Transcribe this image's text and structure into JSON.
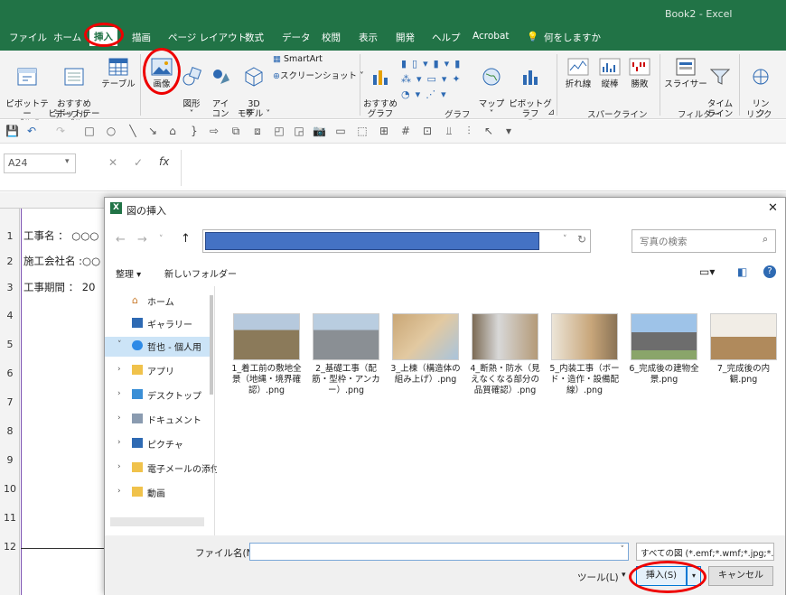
{
  "window": {
    "title": "Book2 - Excel"
  },
  "tabs": [
    "ファイル",
    "ホーム",
    "挿入",
    "描画",
    "ページ レイアウト",
    "数式",
    "データ",
    "校閲",
    "表示",
    "開発",
    "ヘルプ",
    "Acrobat"
  ],
  "tell_me": "何をしますか",
  "ribbon": {
    "pivot": "ピボットテー\nブル ˅",
    "rec_pivot": "おすすめ\nピボットテーブル",
    "table": "テーブル",
    "image": "画像",
    "shapes": "図形\n˅",
    "icons": "アイ\nコン",
    "model3d": "3D\nモデル ˅",
    "smartart": "SmartArt",
    "screenshot": "スクリーンショット ˅",
    "rec_chart": "おすすめ\nグラフ",
    "map": "マップ\n˅",
    "pivot_chart": "ピボットグラフ\n˅",
    "line": "折れ線",
    "column": "縦棒",
    "winloss": "勝敗",
    "slicer": "スライサー",
    "timeline": "タイム\nライン",
    "link": "リン\nク",
    "groups": {
      "table": "テーブル",
      "chart": "グラフ",
      "sparkline": "スパークライン",
      "filter": "フィルター",
      "link": "リンク"
    }
  },
  "namebox": "A24",
  "sheet": {
    "rows": [
      "1",
      "2",
      "3",
      "4",
      "5",
      "6",
      "7",
      "8",
      "9",
      "10",
      "11",
      "12"
    ],
    "cells": [
      "工事名 ： ○○○",
      "施工会社名 :○○",
      "工事期間 ：  20"
    ]
  },
  "dialog": {
    "title": "図の挿入",
    "search_placeholder": "写真の検索",
    "organize": "整理 ▾",
    "new_folder": "新しいフォルダー",
    "nav": [
      {
        "label": "ホーム",
        "chev": ""
      },
      {
        "label": "ギャラリー",
        "chev": ""
      },
      {
        "label": "哲也 - 個人用",
        "chev": "˅"
      },
      {
        "label": "アプリ",
        "chev": "›"
      },
      {
        "label": "デスクトップ",
        "chev": "›"
      },
      {
        "label": "ドキュメント",
        "chev": "›"
      },
      {
        "label": "ピクチャ",
        "chev": "›"
      },
      {
        "label": "電子メールの添付",
        "chev": "›"
      },
      {
        "label": "動画",
        "chev": "›"
      }
    ],
    "files": [
      "1_着工前の敷地全景（地縄・境界確認）.png",
      "2_基礎工事（配筋・型枠・アンカー）.png",
      "3_上棟（構造体の組み上げ）.png",
      "4_断熱・防水（見えなくなる部分の品質確認）.png",
      "5_内装工事（ボード・造作・設備配線）.png",
      "6_完成後の建物全景.png",
      "7_完成後の内観.png"
    ],
    "filename_label": "ファイル名(N):",
    "filename_value": "",
    "filter": "すべての図 (*.emf;*.wmf;*.jpg;*.jp",
    "tools": "ツール(L)",
    "insert": "挿入(S)",
    "cancel": "キャンセル"
  }
}
